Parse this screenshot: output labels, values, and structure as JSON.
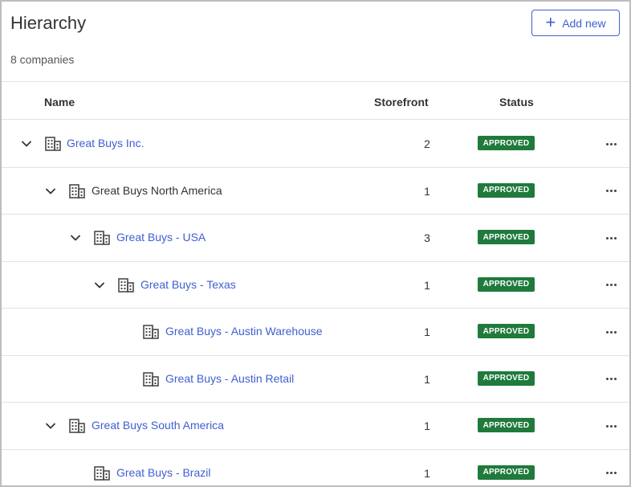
{
  "header": {
    "title": "Hierarchy",
    "count": "8 companies",
    "add_label": "Add new"
  },
  "columns": {
    "name": "Name",
    "storefront": "Storefront",
    "status": "Status"
  },
  "rows": [
    {
      "name": "Great Buys Inc.",
      "storefront": "2",
      "status": "APPROVED",
      "level": 0,
      "expandable": true,
      "style": "link"
    },
    {
      "name": "Great Buys North America",
      "storefront": "1",
      "status": "APPROVED",
      "level": 1,
      "expandable": true,
      "style": "plain"
    },
    {
      "name": "Great Buys - USA",
      "storefront": "3",
      "status": "APPROVED",
      "level": 2,
      "expandable": true,
      "style": "link"
    },
    {
      "name": "Great Buys - Texas",
      "storefront": "1",
      "status": "APPROVED",
      "level": 3,
      "expandable": true,
      "style": "link"
    },
    {
      "name": "Great Buys - Austin Warehouse",
      "storefront": "1",
      "status": "APPROVED",
      "level": 4,
      "expandable": false,
      "style": "link"
    },
    {
      "name": "Great Buys - Austin Retail",
      "storefront": "1",
      "status": "APPROVED",
      "level": 4,
      "expandable": false,
      "style": "link"
    },
    {
      "name": "Great Buys South America",
      "storefront": "1",
      "status": "APPROVED",
      "level": 1,
      "expandable": true,
      "style": "link"
    },
    {
      "name": "Great Buys - Brazil",
      "storefront": "1",
      "status": "APPROVED",
      "level": 2,
      "expandable": false,
      "style": "link"
    }
  ],
  "icons": {
    "expand": "chevron-down-icon",
    "company": "building-icon",
    "actions": "more-horizontal-icon",
    "add": "plus-icon"
  },
  "colors": {
    "accent": "#3f5fd1",
    "approved": "#1f7a3c"
  }
}
